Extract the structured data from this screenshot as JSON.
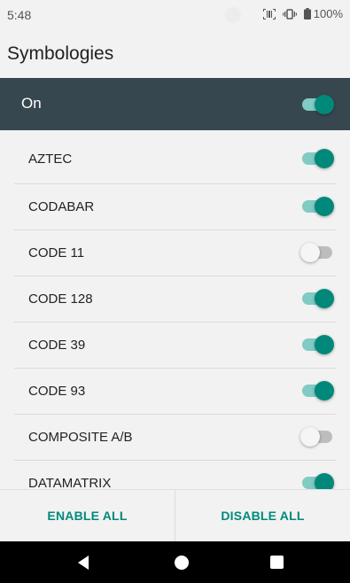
{
  "status_bar": {
    "time": "5:48",
    "battery_text": "100%",
    "icons": [
      "scanner-icon",
      "vibrate-icon",
      "battery-icon"
    ]
  },
  "header": {
    "title": "Symbologies"
  },
  "master": {
    "label": "On",
    "enabled": true
  },
  "symbologies": [
    {
      "label": "AZTEC",
      "enabled": true
    },
    {
      "label": "CODABAR",
      "enabled": true
    },
    {
      "label": "CODE 11",
      "enabled": false
    },
    {
      "label": "CODE 128",
      "enabled": true
    },
    {
      "label": "CODE 39",
      "enabled": true
    },
    {
      "label": "CODE 93",
      "enabled": true
    },
    {
      "label": "COMPOSITE A/B",
      "enabled": false
    },
    {
      "label": "DATAMATRIX",
      "enabled": true
    }
  ],
  "actions": {
    "enable_all": "ENABLE ALL",
    "disable_all": "DISABLE ALL"
  },
  "colors": {
    "accent": "#00897b",
    "master_bar": "#37474f"
  },
  "nav": {
    "icons": [
      "back-icon",
      "home-icon",
      "recents-icon"
    ]
  }
}
